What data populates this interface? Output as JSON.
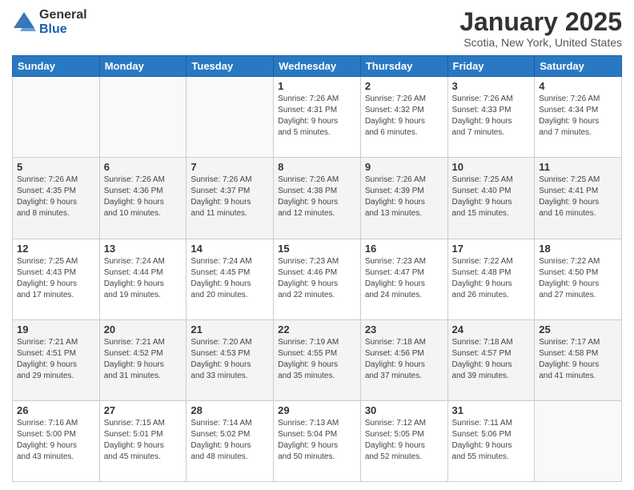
{
  "logo": {
    "general": "General",
    "blue": "Blue"
  },
  "header": {
    "month": "January 2025",
    "location": "Scotia, New York, United States"
  },
  "weekdays": [
    "Sunday",
    "Monday",
    "Tuesday",
    "Wednesday",
    "Thursday",
    "Friday",
    "Saturday"
  ],
  "weeks": [
    [
      {
        "day": "",
        "info": ""
      },
      {
        "day": "",
        "info": ""
      },
      {
        "day": "",
        "info": ""
      },
      {
        "day": "1",
        "info": "Sunrise: 7:26 AM\nSunset: 4:31 PM\nDaylight: 9 hours\nand 5 minutes."
      },
      {
        "day": "2",
        "info": "Sunrise: 7:26 AM\nSunset: 4:32 PM\nDaylight: 9 hours\nand 6 minutes."
      },
      {
        "day": "3",
        "info": "Sunrise: 7:26 AM\nSunset: 4:33 PM\nDaylight: 9 hours\nand 7 minutes."
      },
      {
        "day": "4",
        "info": "Sunrise: 7:26 AM\nSunset: 4:34 PM\nDaylight: 9 hours\nand 7 minutes."
      }
    ],
    [
      {
        "day": "5",
        "info": "Sunrise: 7:26 AM\nSunset: 4:35 PM\nDaylight: 9 hours\nand 8 minutes."
      },
      {
        "day": "6",
        "info": "Sunrise: 7:26 AM\nSunset: 4:36 PM\nDaylight: 9 hours\nand 10 minutes."
      },
      {
        "day": "7",
        "info": "Sunrise: 7:26 AM\nSunset: 4:37 PM\nDaylight: 9 hours\nand 11 minutes."
      },
      {
        "day": "8",
        "info": "Sunrise: 7:26 AM\nSunset: 4:38 PM\nDaylight: 9 hours\nand 12 minutes."
      },
      {
        "day": "9",
        "info": "Sunrise: 7:26 AM\nSunset: 4:39 PM\nDaylight: 9 hours\nand 13 minutes."
      },
      {
        "day": "10",
        "info": "Sunrise: 7:25 AM\nSunset: 4:40 PM\nDaylight: 9 hours\nand 15 minutes."
      },
      {
        "day": "11",
        "info": "Sunrise: 7:25 AM\nSunset: 4:41 PM\nDaylight: 9 hours\nand 16 minutes."
      }
    ],
    [
      {
        "day": "12",
        "info": "Sunrise: 7:25 AM\nSunset: 4:43 PM\nDaylight: 9 hours\nand 17 minutes."
      },
      {
        "day": "13",
        "info": "Sunrise: 7:24 AM\nSunset: 4:44 PM\nDaylight: 9 hours\nand 19 minutes."
      },
      {
        "day": "14",
        "info": "Sunrise: 7:24 AM\nSunset: 4:45 PM\nDaylight: 9 hours\nand 20 minutes."
      },
      {
        "day": "15",
        "info": "Sunrise: 7:23 AM\nSunset: 4:46 PM\nDaylight: 9 hours\nand 22 minutes."
      },
      {
        "day": "16",
        "info": "Sunrise: 7:23 AM\nSunset: 4:47 PM\nDaylight: 9 hours\nand 24 minutes."
      },
      {
        "day": "17",
        "info": "Sunrise: 7:22 AM\nSunset: 4:48 PM\nDaylight: 9 hours\nand 26 minutes."
      },
      {
        "day": "18",
        "info": "Sunrise: 7:22 AM\nSunset: 4:50 PM\nDaylight: 9 hours\nand 27 minutes."
      }
    ],
    [
      {
        "day": "19",
        "info": "Sunrise: 7:21 AM\nSunset: 4:51 PM\nDaylight: 9 hours\nand 29 minutes."
      },
      {
        "day": "20",
        "info": "Sunrise: 7:21 AM\nSunset: 4:52 PM\nDaylight: 9 hours\nand 31 minutes."
      },
      {
        "day": "21",
        "info": "Sunrise: 7:20 AM\nSunset: 4:53 PM\nDaylight: 9 hours\nand 33 minutes."
      },
      {
        "day": "22",
        "info": "Sunrise: 7:19 AM\nSunset: 4:55 PM\nDaylight: 9 hours\nand 35 minutes."
      },
      {
        "day": "23",
        "info": "Sunrise: 7:18 AM\nSunset: 4:56 PM\nDaylight: 9 hours\nand 37 minutes."
      },
      {
        "day": "24",
        "info": "Sunrise: 7:18 AM\nSunset: 4:57 PM\nDaylight: 9 hours\nand 39 minutes."
      },
      {
        "day": "25",
        "info": "Sunrise: 7:17 AM\nSunset: 4:58 PM\nDaylight: 9 hours\nand 41 minutes."
      }
    ],
    [
      {
        "day": "26",
        "info": "Sunrise: 7:16 AM\nSunset: 5:00 PM\nDaylight: 9 hours\nand 43 minutes."
      },
      {
        "day": "27",
        "info": "Sunrise: 7:15 AM\nSunset: 5:01 PM\nDaylight: 9 hours\nand 45 minutes."
      },
      {
        "day": "28",
        "info": "Sunrise: 7:14 AM\nSunset: 5:02 PM\nDaylight: 9 hours\nand 48 minutes."
      },
      {
        "day": "29",
        "info": "Sunrise: 7:13 AM\nSunset: 5:04 PM\nDaylight: 9 hours\nand 50 minutes."
      },
      {
        "day": "30",
        "info": "Sunrise: 7:12 AM\nSunset: 5:05 PM\nDaylight: 9 hours\nand 52 minutes."
      },
      {
        "day": "31",
        "info": "Sunrise: 7:11 AM\nSunset: 5:06 PM\nDaylight: 9 hours\nand 55 minutes."
      },
      {
        "day": "",
        "info": ""
      }
    ]
  ]
}
